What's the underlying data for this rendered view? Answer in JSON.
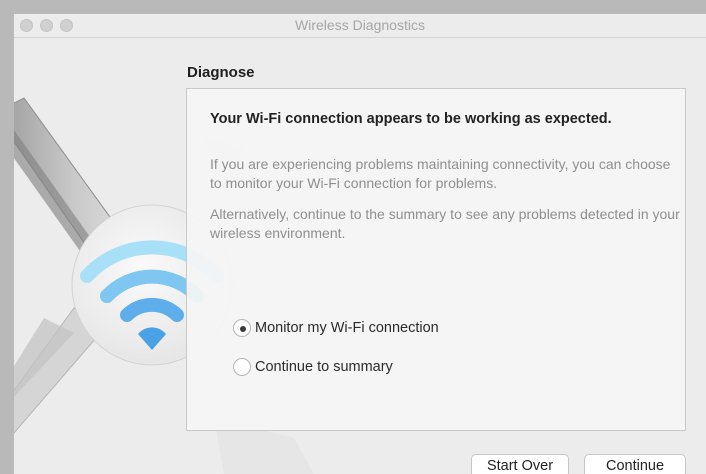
{
  "window": {
    "title": "Wireless Diagnostics"
  },
  "main": {
    "section_title": "Diagnose",
    "heading": "Your Wi-Fi connection appears to be working as expected.",
    "paragraph1": "If you are experiencing problems maintaining connectivity, you can choose to monitor your Wi-Fi connection for problems.",
    "paragraph2": "Alternatively, continue to the summary to see any problems detected in your wireless environment.",
    "options": [
      {
        "label": "Monitor my Wi-Fi connection",
        "selected": true
      },
      {
        "label": "Continue to summary",
        "selected": false
      }
    ]
  },
  "footer": {
    "start_over_label": "Start Over",
    "continue_label": "Continue"
  },
  "colors": {
    "wifi_top": "#8fd8f5",
    "wifi_bottom": "#3f9fe6"
  }
}
